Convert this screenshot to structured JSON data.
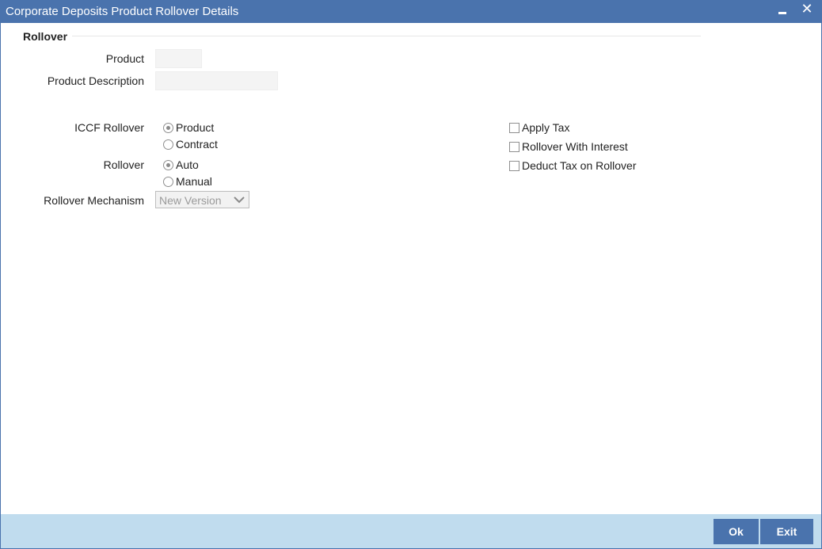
{
  "window": {
    "title": "Corporate Deposits Product Rollover Details",
    "minimize_icon": "minimize-icon",
    "close_icon": "close-icon",
    "close_glyph": "✕"
  },
  "section": {
    "title": "Rollover"
  },
  "fields": {
    "product_label": "Product",
    "product_value": "",
    "product_description_label": "Product Description",
    "product_description_value": ""
  },
  "iccf_rollover": {
    "label": "ICCF Rollover",
    "options": [
      {
        "label": "Product",
        "checked": true
      },
      {
        "label": "Contract",
        "checked": false
      }
    ]
  },
  "rollover": {
    "label": "Rollover",
    "options": [
      {
        "label": "Auto",
        "checked": true
      },
      {
        "label": "Manual",
        "checked": false
      }
    ]
  },
  "rollover_mechanism": {
    "label": "Rollover Mechanism",
    "selected": "New Version",
    "icon": "chevron-down-icon"
  },
  "checkboxes": [
    {
      "label": "Apply Tax",
      "checked": false
    },
    {
      "label": "Rollover With Interest",
      "checked": false
    },
    {
      "label": "Deduct Tax on Rollover",
      "checked": false
    }
  ],
  "footer": {
    "ok_label": "Ok",
    "exit_label": "Exit"
  },
  "colors": {
    "titlebar": "#4a73ad",
    "footer": "#c0dcee",
    "button": "#4a73ad"
  }
}
